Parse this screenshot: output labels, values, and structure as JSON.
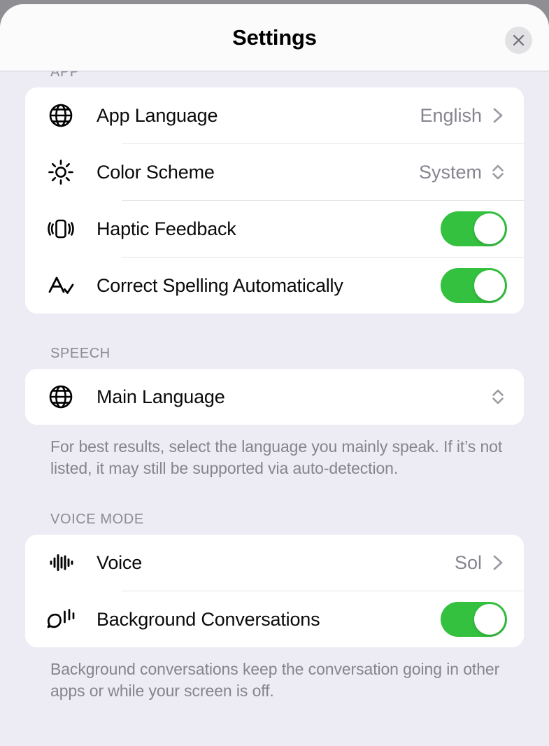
{
  "header": {
    "title": "Settings",
    "close_label": "Close",
    "close_icon": "close-icon"
  },
  "colors": {
    "background": "#edebf4",
    "card": "#ffffff",
    "toggle_on": "#33c13f",
    "secondary_text": "#86858f",
    "section_label": "#8b8a96",
    "divider": "#e6e5e9",
    "close_button_bg": "#e2e1e4"
  },
  "sections": [
    {
      "label": "APP",
      "rows": [
        {
          "icon": "globe-icon",
          "label": "App Language",
          "value": "English",
          "accessory": "chevron-right-icon"
        },
        {
          "icon": "sun-brightness-icon",
          "label": "Color Scheme",
          "value": "System",
          "accessory": "chevron-updown-icon"
        },
        {
          "icon": "haptic-vibration-icon",
          "label": "Haptic Feedback",
          "value": "",
          "accessory": "toggle",
          "toggle_state": "on"
        },
        {
          "icon": "spellcheck-icon",
          "label": "Correct Spelling Automatically",
          "value": "",
          "accessory": "toggle",
          "toggle_state": "on"
        }
      ],
      "footnote": ""
    },
    {
      "label": "SPEECH",
      "rows": [
        {
          "icon": "globe-icon",
          "label": "Main Language",
          "value": "",
          "accessory": "chevron-updown-icon"
        }
      ],
      "footnote": "For best results, select the language you mainly speak. If it’s not listed, it may still be supported via auto-detection."
    },
    {
      "label": "VOICE MODE",
      "rows": [
        {
          "icon": "waveform-icon",
          "label": "Voice",
          "value": "Sol",
          "accessory": "chevron-right-icon"
        },
        {
          "icon": "speech-bubble-waves-icon",
          "label": "Background Conversations",
          "value": "",
          "accessory": "toggle",
          "toggle_state": "on"
        }
      ],
      "footnote": "Background conversations keep the conversation going in other apps or while your screen is off."
    }
  ]
}
